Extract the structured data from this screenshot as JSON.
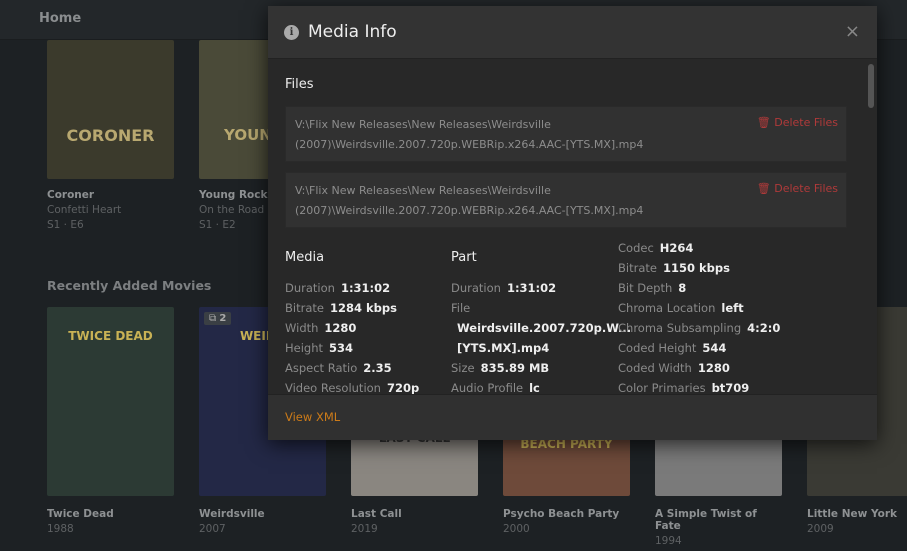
{
  "header": {
    "title": "Home"
  },
  "on_deck": [
    {
      "title": "Coroner",
      "subtitle": "Confetti Heart",
      "meta": "S1 · E6",
      "poster_text": "CORONER",
      "color": "#3b3a2c"
    },
    {
      "title": "Young Rock",
      "subtitle": "On the Road",
      "meta": "S1 · E2",
      "poster_text": "YOUNG R",
      "color": "#4a4a38"
    }
  ],
  "recent": {
    "title": "Recently Added Movies",
    "items": [
      {
        "title": "Twice Dead",
        "year": "1988",
        "poster_text": "TWICE DEAD",
        "color": "#2c3a34"
      },
      {
        "title": "Weirdsville",
        "year": "2007",
        "poster_text": "WEIRD",
        "color": "#232846",
        "badge": "2"
      },
      {
        "title": "Last Call",
        "year": "2019",
        "poster_text": "LAST CALL",
        "color": "#8a8680"
      },
      {
        "title": "Psycho Beach Party",
        "year": "2000",
        "poster_text": "BEACH PARTY",
        "color": "#6e4a3a"
      },
      {
        "title": "A Simple Twist of Fate",
        "year": "1994",
        "poster_text": "",
        "color": "#7a7a7a"
      },
      {
        "title": "Little New York",
        "year": "2009",
        "poster_text": "",
        "color": "#3a3a34"
      }
    ]
  },
  "modal": {
    "title": "Media Info",
    "close": "×",
    "files_title": "Files",
    "delete_label": "Delete Files",
    "view_xml": "View XML",
    "files": [
      {
        "line1": "V:\\Flix New Releases\\New Releases\\Weirdsville",
        "line2": "(2007)\\Weirdsville.2007.720p.WEBRip.x264.AAC-[YTS.MX].mp4"
      },
      {
        "line1": "V:\\Flix New Releases\\New Releases\\Weirdsville",
        "line2": "(2007)\\Weirdsville.2007.720p.WEBRip.x264.AAC-[YTS.MX].mp4"
      }
    ],
    "media": {
      "title": "Media",
      "rows": [
        [
          "Duration",
          "1:31:02"
        ],
        [
          "Bitrate",
          "1284 kbps"
        ],
        [
          "Width",
          "1280"
        ],
        [
          "Height",
          "534"
        ],
        [
          "Aspect Ratio",
          "2.35"
        ],
        [
          "Video Resolution",
          "720p"
        ]
      ]
    },
    "part": {
      "title": "Part",
      "rows": [
        [
          "Duration",
          "1:31:02"
        ],
        [
          "File",
          ""
        ],
        [
          "",
          "Weirdsville.2007.720p.W..."
        ],
        [
          "",
          "[YTS.MX].mp4"
        ],
        [
          "Size",
          "835.89 MB"
        ],
        [
          "Audio Profile",
          "lc"
        ]
      ]
    },
    "stream": {
      "rows": [
        [
          "Codec",
          "H264"
        ],
        [
          "Bitrate",
          "1150 kbps"
        ],
        [
          "Bit Depth",
          "8"
        ],
        [
          "Chroma Location",
          "left"
        ],
        [
          "Chroma Subsampling",
          "4:2:0"
        ],
        [
          "Coded Height",
          "544"
        ],
        [
          "Coded Width",
          "1280"
        ],
        [
          "Color Primaries",
          "bt709"
        ]
      ]
    }
  }
}
